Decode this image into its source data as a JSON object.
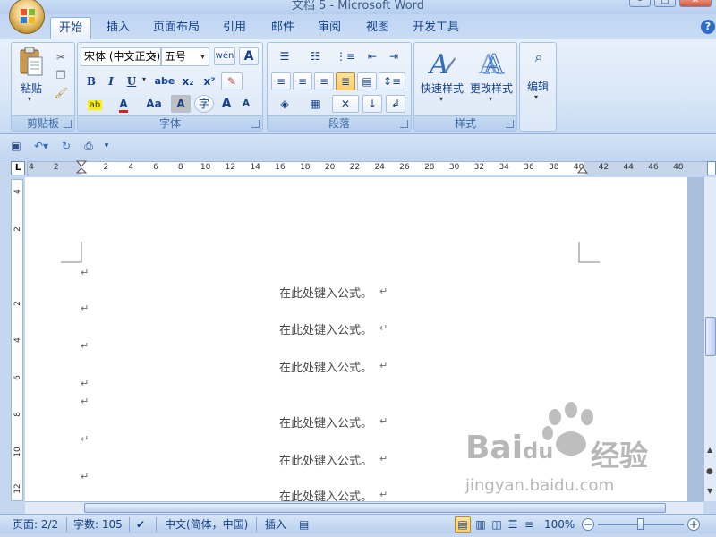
{
  "window": {
    "title": "文档 5 - Microsoft Word",
    "minimize": "–",
    "maximize": "□",
    "close": "✕"
  },
  "tabs": [
    {
      "label": "开始",
      "active": true
    },
    {
      "label": "插入"
    },
    {
      "label": "页面布局"
    },
    {
      "label": "引用"
    },
    {
      "label": "邮件"
    },
    {
      "label": "审阅"
    },
    {
      "label": "视图"
    },
    {
      "label": "开发工具"
    }
  ],
  "help": "?",
  "ribbon": {
    "clipboard": {
      "label": "剪贴板",
      "paste": "粘贴"
    },
    "font": {
      "label": "字体",
      "font_name": "宋体 (中文正文)",
      "font_size": "五号",
      "bold": "B",
      "italic": "I",
      "underline": "U",
      "strike": "abe",
      "subscript": "x₂",
      "superscript": "x²",
      "change_case": "Aa",
      "grow": "A",
      "shrink": "A",
      "phonetic": "wén",
      "border_char": "A",
      "shade_char": "A",
      "circle_char": "字"
    },
    "paragraph": {
      "label": "段落"
    },
    "styles": {
      "label": "样式",
      "quick": "快速样式",
      "change": "更改样式"
    },
    "editing": {
      "label": "编辑"
    }
  },
  "ruler": {
    "h_numbers": [
      "4",
      "2",
      "",
      "2",
      "4",
      "6",
      "8",
      "10",
      "12",
      "14",
      "16",
      "18",
      "20",
      "22",
      "24",
      "26",
      "28",
      "30",
      "32",
      "34",
      "36",
      "38",
      "40",
      "42",
      "44",
      "46",
      "48"
    ],
    "v_numbers": [
      "4",
      "2",
      "",
      "2",
      "4",
      "6",
      "8",
      "10",
      "12"
    ],
    "tab_selector": "L"
  },
  "document": {
    "lines": [
      {
        "text": "",
        "mark": "↵"
      },
      {
        "text": "在此处键入公式。",
        "mark": "↵"
      },
      {
        "text": "",
        "mark": "↵"
      },
      {
        "text": "在此处键入公式。",
        "mark": "↵"
      },
      {
        "text": "",
        "mark": "↵"
      },
      {
        "text": "在此处键入公式。",
        "mark": "↵"
      },
      {
        "text": "",
        "mark": "↵"
      },
      {
        "text": "",
        "mark": "↵"
      },
      {
        "text": "在此处键入公式。",
        "mark": "↵"
      },
      {
        "text": "",
        "mark": "↵"
      },
      {
        "text": "在此处键入公式。",
        "mark": "↵"
      },
      {
        "text": "",
        "mark": "↵"
      },
      {
        "text": "在此处键入公式。",
        "mark": "↵"
      }
    ]
  },
  "status": {
    "page": "页面: 2/2",
    "words": "字数: 105",
    "language": "中文(简体，中国)",
    "mode": "插入",
    "zoom": "100%",
    "zoom_minus": "−",
    "zoom_plus": "+"
  },
  "watermark": {
    "brand": "Bai",
    "brand2": "du",
    "cn": "经验",
    "url": "jingyan.baidu.com"
  },
  "colors": {
    "accent": "#15428b",
    "ribbon_bg": "#dce8f7",
    "active_btn": "#ffcf6b"
  }
}
